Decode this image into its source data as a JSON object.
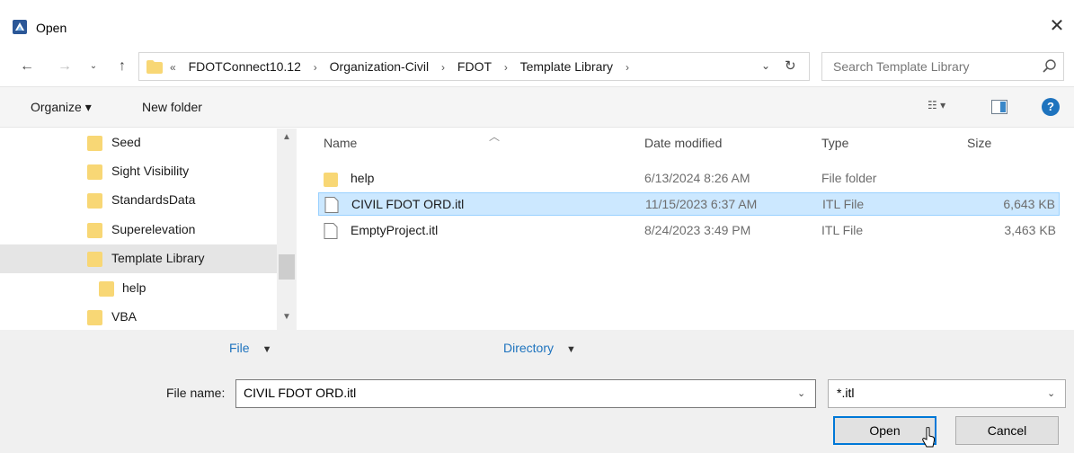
{
  "window": {
    "title": "Open"
  },
  "nav": {
    "breadcrumb_prefix": "«",
    "breadcrumbs": [
      "FDOTConnect10.12",
      "Organization-Civil",
      "FDOT",
      "Template Library"
    ],
    "search_placeholder": "Search Template Library"
  },
  "toolbar": {
    "organize_label": "Organize ▾",
    "new_folder_label": "New folder"
  },
  "sidebar": {
    "items": [
      {
        "label": "Seed"
      },
      {
        "label": "Sight Visibility"
      },
      {
        "label": "StandardsData"
      },
      {
        "label": "Superelevation"
      },
      {
        "label": "Template Library"
      },
      {
        "label": "help"
      },
      {
        "label": "VBA"
      }
    ],
    "selected": "Template Library"
  },
  "files": {
    "columns": {
      "name": "Name",
      "date": "Date modified",
      "type": "Type",
      "size": "Size"
    },
    "rows": [
      {
        "name": "help",
        "date": "6/13/2024 8:26 AM",
        "type": "File folder",
        "size": ""
      },
      {
        "name": "CIVIL FDOT ORD.itl",
        "date": "11/15/2023 6:37 AM",
        "type": "ITL File",
        "size": "6,643 KB"
      },
      {
        "name": "EmptyProject.itl",
        "date": "8/24/2023 3:49 PM",
        "type": "ITL File",
        "size": "3,463 KB"
      }
    ],
    "selected_index": 1
  },
  "bottom": {
    "file_menu": "File",
    "directory_menu": "Directory",
    "filename_label": "File name:",
    "filename_value": "CIVIL FDOT ORD.itl",
    "filetype_value": "*.itl",
    "open_label": "Open",
    "cancel_label": "Cancel"
  },
  "colors": {
    "accent": "#0078d7",
    "selection": "#cce8ff",
    "folder": "#f8d775",
    "link": "#1e73be"
  }
}
